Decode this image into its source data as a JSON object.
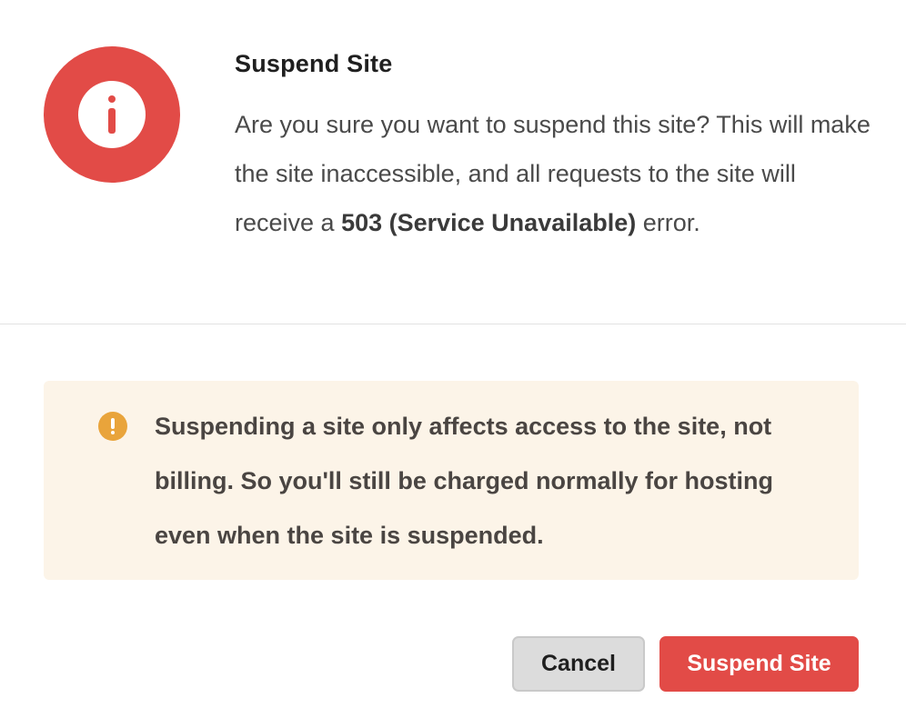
{
  "dialog": {
    "title": "Suspend Site",
    "icon": "info-icon",
    "message": {
      "part1": "Are you sure you want to suspend this site? This will make the site inaccessible, and all requests to the site will receive a ",
      "emphasis": "503 (Service Unavailable)",
      "part2": " error."
    }
  },
  "notice": {
    "icon": "warning-icon",
    "text": "Suspending a site only affects access to the site, not billing. So you'll still be charged normally for hosting even when the site is suspended."
  },
  "actions": {
    "cancel_label": "Cancel",
    "confirm_label": "Suspend Site"
  },
  "colors": {
    "danger": "#e24b47",
    "warning": "#e9a43b",
    "notice_bg": "#fcf4e8",
    "button_neutral": "#dcdcdc"
  }
}
